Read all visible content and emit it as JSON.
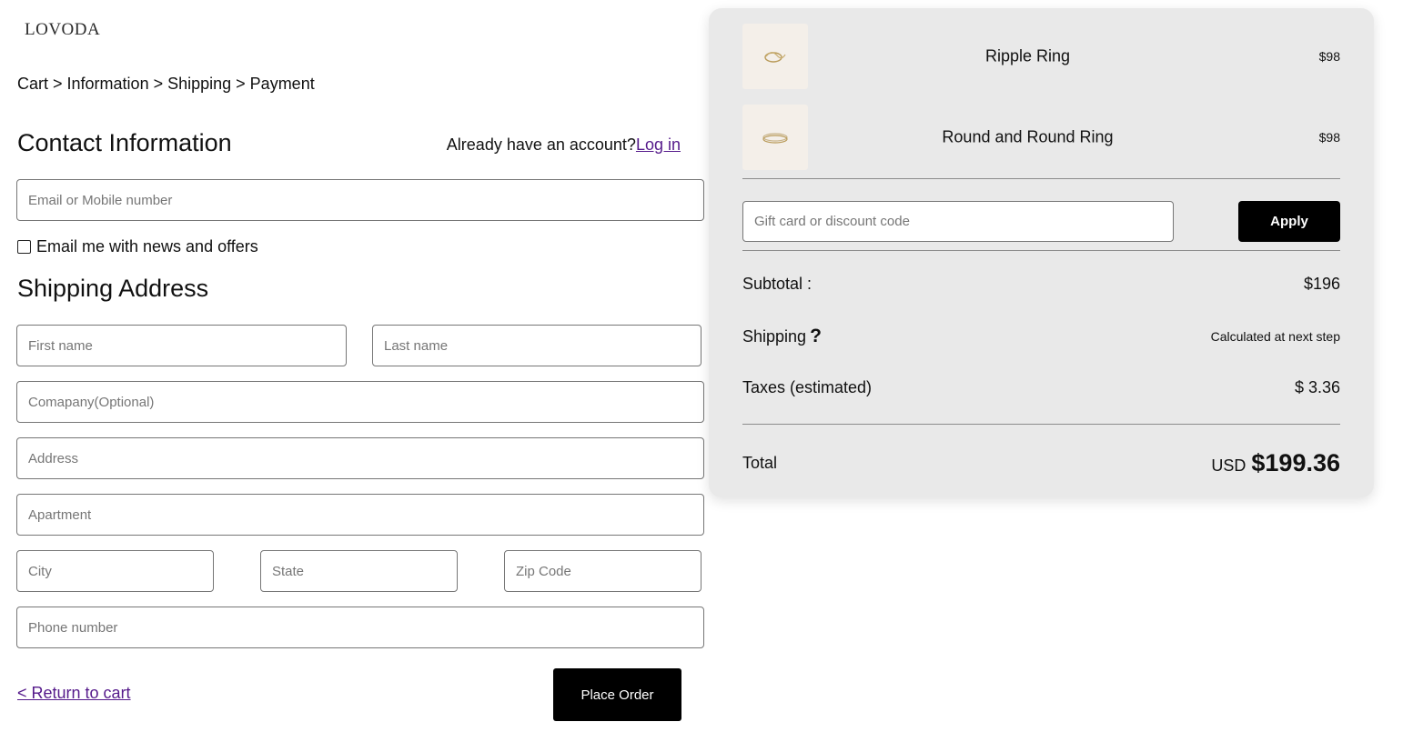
{
  "brand": {
    "logo_text": "LOVODA"
  },
  "breadcrumb": {
    "items": [
      "Cart",
      "Information",
      "Shipping",
      "Payment"
    ],
    "separator": " > "
  },
  "contact": {
    "title": "Contact Information",
    "account_prompt": "Already have an account?",
    "login_label": "Log in",
    "email_placeholder": "Email or Mobile number",
    "newsletter_label": "Email me with news and offers",
    "newsletter_checked": false
  },
  "shipping": {
    "title": "Shipping Address",
    "first_name_placeholder": "First name",
    "last_name_placeholder": "Last name",
    "company_placeholder": "Comapany(Optional)",
    "address_placeholder": "Address",
    "apartment_placeholder": "Apartment",
    "city_placeholder": "City",
    "state_placeholder": "State",
    "zip_placeholder": "Zip Code",
    "phone_placeholder": "Phone number"
  },
  "actions": {
    "return_label": "< Return to cart",
    "place_order_label": "Place Order"
  },
  "summary": {
    "items": [
      {
        "name": "Ripple Ring",
        "price": "$98",
        "thumb_icon": "ring-image"
      },
      {
        "name": "Round and Round Ring",
        "price": "$98",
        "thumb_icon": "ring-image"
      }
    ],
    "discount_placeholder": "Gift card or discount code",
    "apply_label": "Apply",
    "subtotal_label": "Subtotal :",
    "subtotal_value": "$196",
    "shipping_label": "Shipping",
    "shipping_help_icon": "?",
    "shipping_value": "Calculated at next step",
    "taxes_label": "Taxes (estimated)",
    "taxes_value": "$ 3.36",
    "total_label": "Total",
    "total_currency": "USD",
    "total_value": "$199.36"
  },
  "colors": {
    "panel_bg": "#e9e9e9",
    "button_bg": "#000000",
    "link": "#551a8b"
  }
}
